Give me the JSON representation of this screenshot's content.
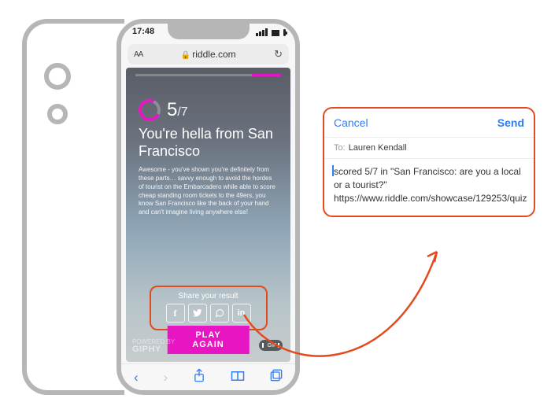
{
  "status": {
    "time": "17:48"
  },
  "browser": {
    "url": "riddle.com",
    "textsize_label": "AA",
    "refresh_icon": "↻"
  },
  "quiz": {
    "score_num": "5",
    "score_total": "/7",
    "headline": "You're hella from San Francisco",
    "description": "Awesome - you've shown you're definitely from these parts… savvy enough to avoid the hordes of tourist on the Embarcadero while able to score cheap standing room tickets to the 49ers, you know San Francisco like the back of your hand and can't imagine living anywhere else!",
    "share_label": "Share your result",
    "play_again": "PLAY AGAIN",
    "gif_badge": "GIF",
    "watermark_small": "POWERED BY",
    "watermark_big": "GIPHY"
  },
  "social": {
    "fb": "f",
    "tw": "𝕏",
    "wa": "✆",
    "li": "in"
  },
  "toolbar": {
    "back": "‹",
    "fwd": "›",
    "share": "⇧",
    "book": "▭",
    "tabs": "⧉"
  },
  "mail": {
    "cancel": "Cancel",
    "send": "Send",
    "to_label": "To:",
    "recipient": "Lauren Kendall",
    "body_line1": "scored 5/7 in \"San Francisco: are you a local or a tourist?\"",
    "body_line2": "https://www.riddle.com/showcase/129253/quiz"
  }
}
